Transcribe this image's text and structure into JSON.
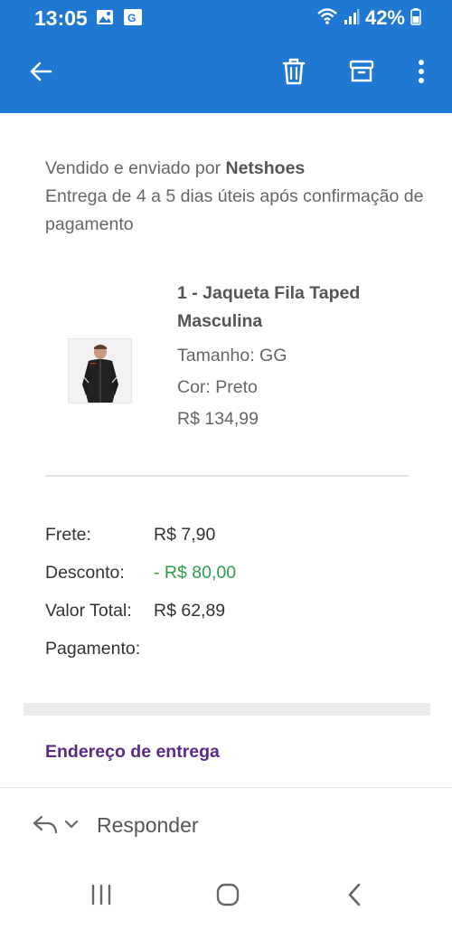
{
  "status_bar": {
    "time": "13:05",
    "battery": "42%",
    "icons": [
      "gallery-icon",
      "translate-icon",
      "wifi-icon",
      "signal-icon",
      "battery-icon"
    ]
  },
  "app_bar": {
    "icons": [
      "back-arrow-icon",
      "trash-icon",
      "archive-icon",
      "more-vert-icon"
    ],
    "color": "#1f78d1"
  },
  "order": {
    "sold_by_prefix": "Vendido e enviado por ",
    "seller": "Netshoes",
    "delivery_text": "Entrega de 4 a 5 dias úteis após confirmação de pagamento",
    "product": {
      "name": "1 - Jaqueta Fila Taped Masculina",
      "size": "Tamanho: GG",
      "color": "Cor: Preto",
      "price": "R$ 134,99"
    },
    "summary": {
      "shipping_label": "Frete:",
      "shipping_value": "R$ 7,90",
      "discount_label": "Desconto:",
      "discount_value": "- R$ 80,00",
      "total_label": "Valor Total:",
      "total_value": "R$ 62,89",
      "payment_label": "Pagamento:"
    },
    "address_title": "Endereço de entrega"
  },
  "reply_bar": {
    "label": "Responder"
  },
  "colors": {
    "accent": "#1f78d1",
    "discount": "#2e9d4a",
    "section_title": "#5b2a86"
  }
}
